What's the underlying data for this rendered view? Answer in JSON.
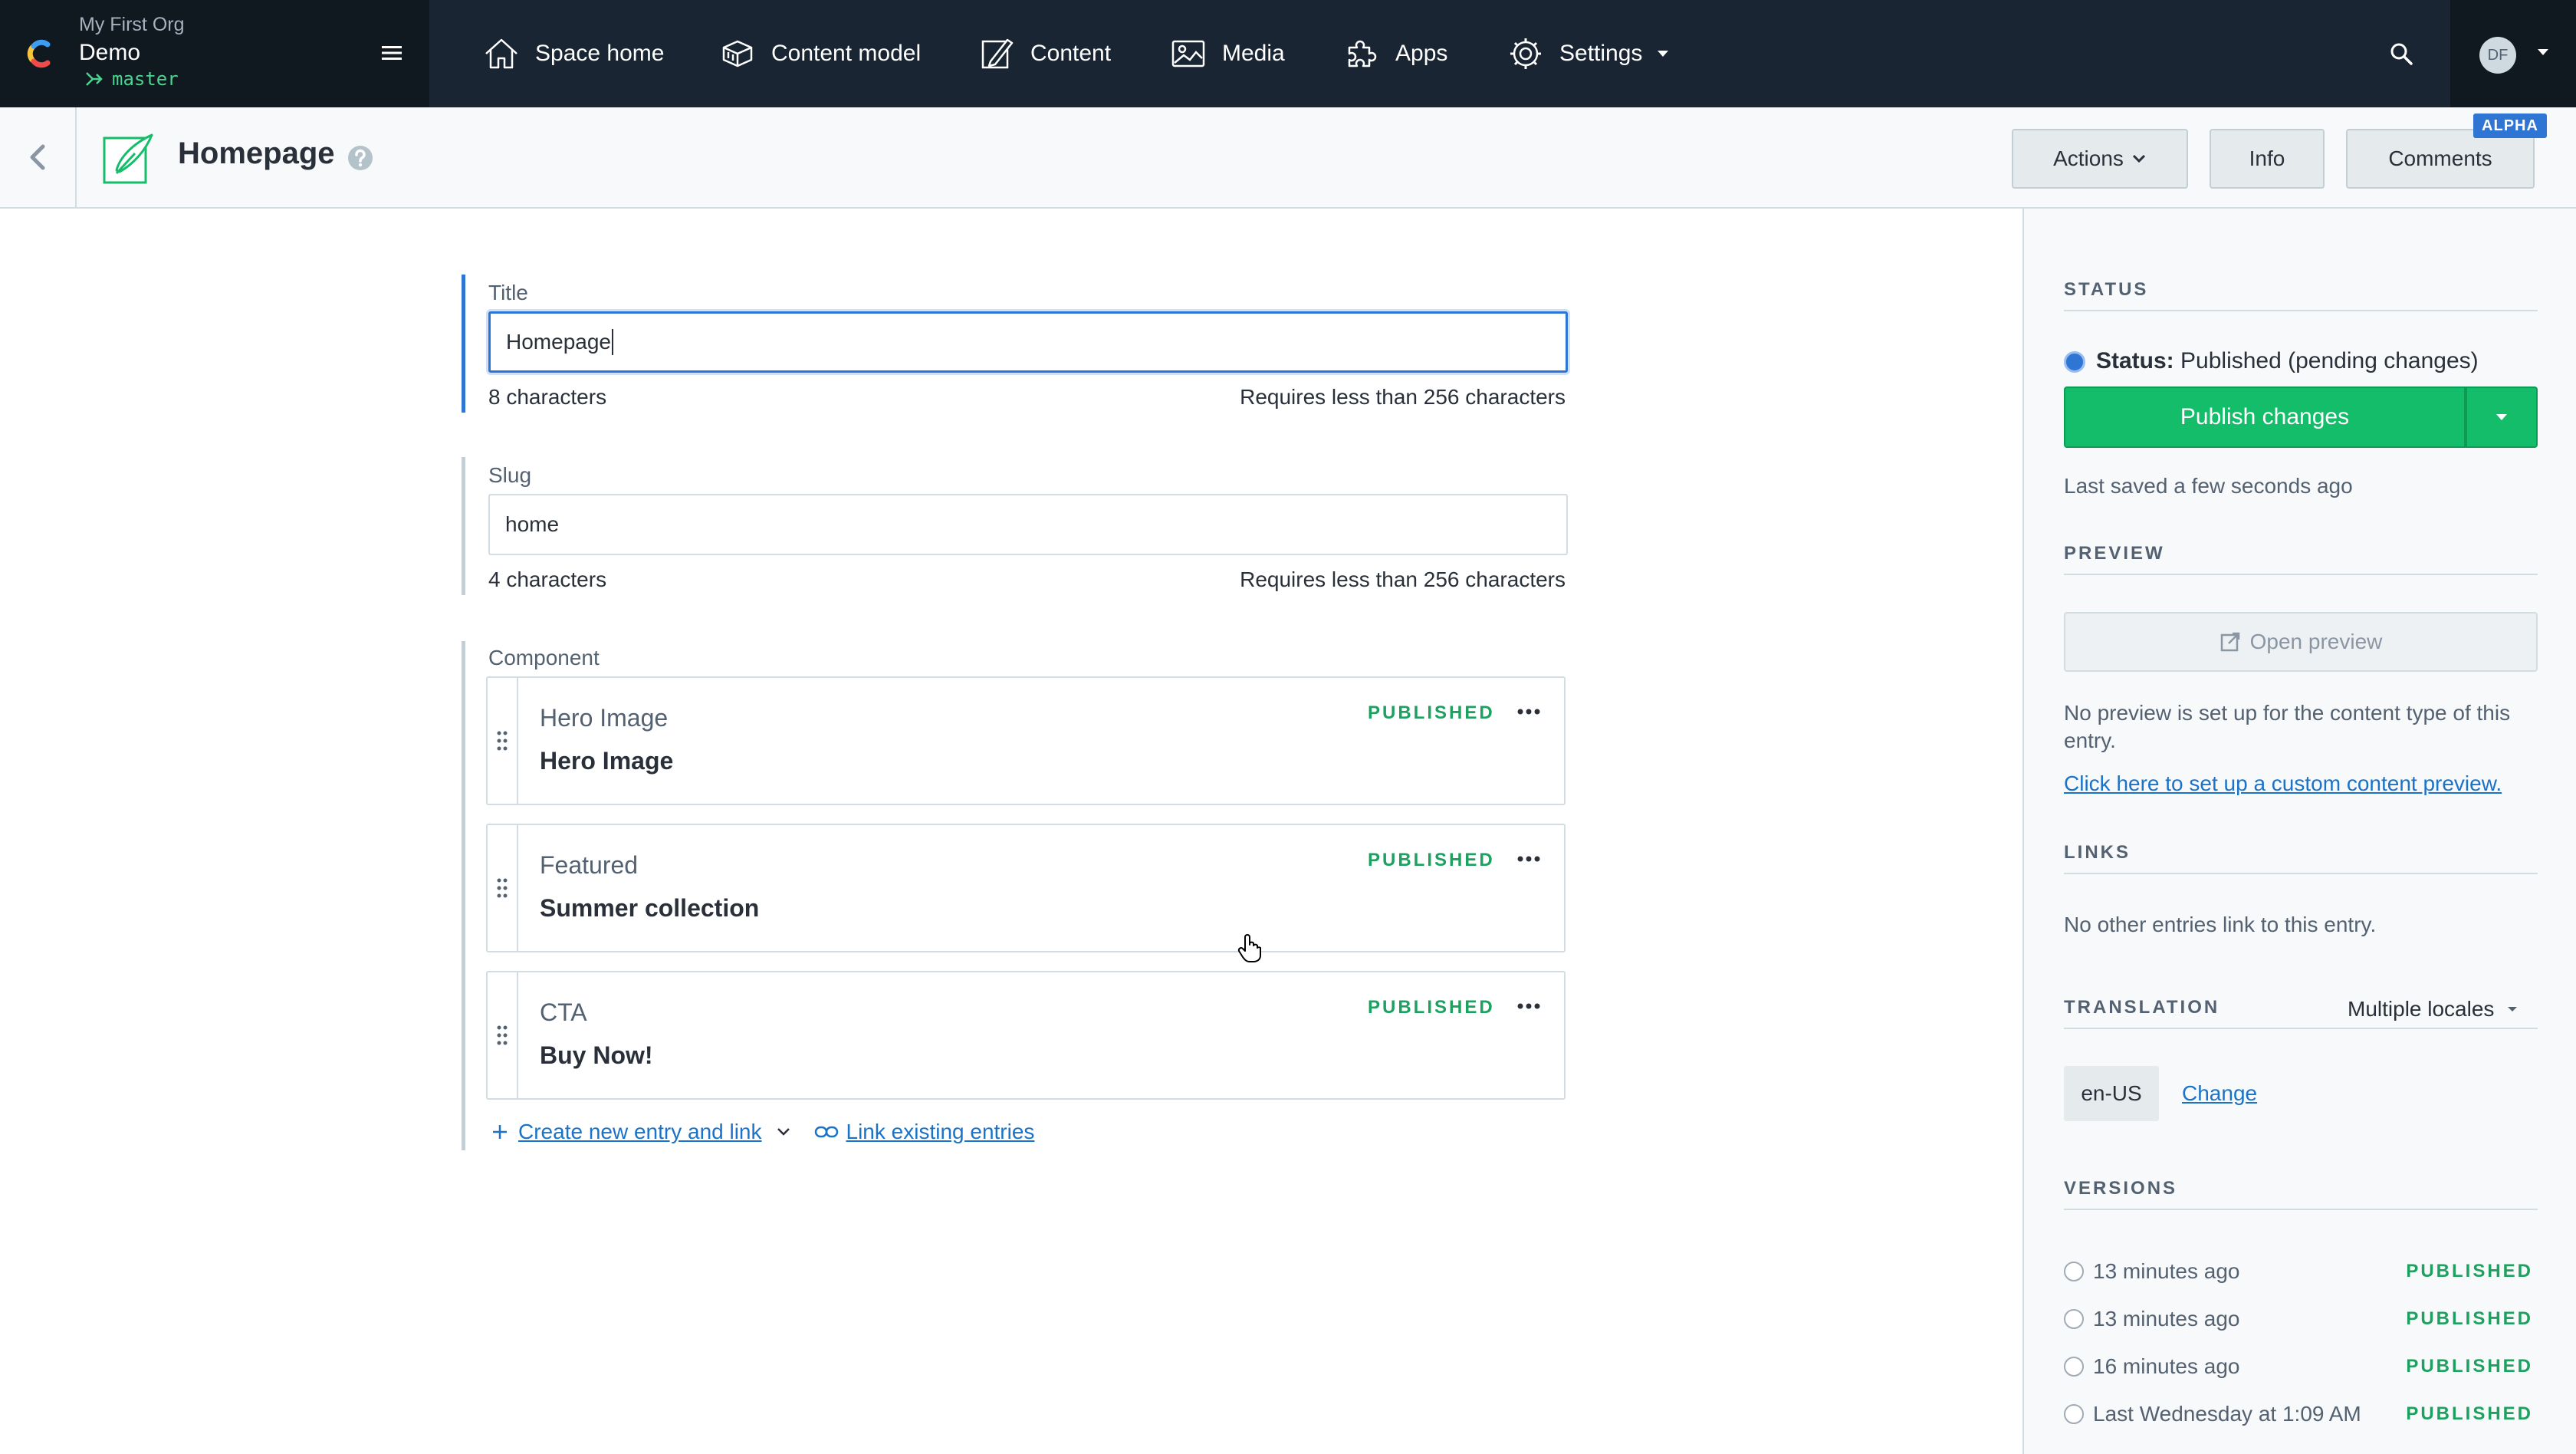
{
  "topnav": {
    "org_name": "My First Org",
    "space_name": "Demo",
    "environment": "master",
    "items": [
      {
        "label": "Space home",
        "icon": "home-icon"
      },
      {
        "label": "Content model",
        "icon": "content-model-icon"
      },
      {
        "label": "Content",
        "icon": "content-icon"
      },
      {
        "label": "Media",
        "icon": "media-icon"
      },
      {
        "label": "Apps",
        "icon": "puzzle-icon"
      },
      {
        "label": "Settings",
        "icon": "gear-icon"
      }
    ],
    "user_initials": "DF"
  },
  "header": {
    "entry_title": "Homepage",
    "actions_label": "Actions",
    "info_label": "Info",
    "comments_label": "Comments",
    "comments_badge": "ALPHA"
  },
  "editor": {
    "title_field": {
      "label": "Title",
      "value": "Homepage",
      "count": "8 characters",
      "limit": "Requires less than 256 characters"
    },
    "slug_field": {
      "label": "Slug",
      "value": "home",
      "count": "4 characters",
      "limit": "Requires less than 256 characters"
    },
    "component_field": {
      "label": "Component",
      "entries": [
        {
          "type": "Hero Image",
          "title": "Hero Image",
          "status": "PUBLISHED"
        },
        {
          "type": "Featured",
          "title": "Summer collection",
          "status": "PUBLISHED"
        },
        {
          "type": "CTA",
          "title": "Buy Now!",
          "status": "PUBLISHED"
        }
      ],
      "create_link": "Create new entry and link",
      "link_existing": "Link existing entries"
    }
  },
  "sidebar": {
    "status_heading": "STATUS",
    "status_label": "Status:",
    "status_value": "Published (pending changes)",
    "publish_button": "Publish changes",
    "last_saved": "Last saved a few seconds ago",
    "preview_heading": "PREVIEW",
    "open_preview": "Open preview",
    "preview_note": "No preview is set up for the content type of this entry.",
    "preview_link": "Click here to set up a custom content preview.",
    "links_heading": "LINKS",
    "links_note": "No other entries link to this entry.",
    "translation_heading": "TRANSLATION",
    "translation_mode": "Multiple locales",
    "locale": "en-US",
    "change_label": "Change",
    "versions_heading": "VERSIONS",
    "versions": [
      {
        "time": "13 minutes ago",
        "status": "PUBLISHED"
      },
      {
        "time": "13 minutes ago",
        "status": "PUBLISHED"
      },
      {
        "time": "16 minutes ago",
        "status": "PUBLISHED"
      },
      {
        "time": "Last Wednesday at 1:09 AM",
        "status": "PUBLISHED"
      }
    ]
  },
  "colors": {
    "nav_bg": "#192532",
    "nav_dark": "#101820",
    "primary_blue": "#2e75d4",
    "publish_green": "#14bd6a",
    "status_green": "#1ea160",
    "env_green": "#4cd38f"
  }
}
